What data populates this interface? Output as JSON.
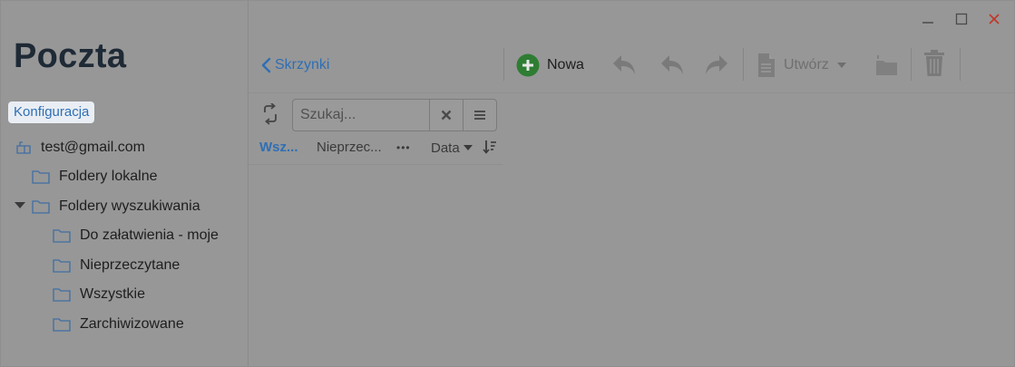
{
  "app": {
    "title": "Poczta"
  },
  "sidebar": {
    "config_label": "Konfiguracja",
    "account": "test@gmail.com",
    "folders": [
      {
        "label": "Foldery lokalne"
      },
      {
        "label": "Foldery wyszukiwania"
      }
    ],
    "search_folders": [
      {
        "label": "Do załatwienia - moje"
      },
      {
        "label": "Nieprzeczytane"
      },
      {
        "label": "Wszystkie"
      },
      {
        "label": "Zarchiwizowane"
      }
    ]
  },
  "toolbar": {
    "back_label": "Skrzynki",
    "new_label": "Nowa",
    "create_label": "Utwórz"
  },
  "search": {
    "placeholder": "Szukaj..."
  },
  "filters": {
    "all": "Wsz...",
    "unread": "Nieprzec...",
    "more": "•••",
    "sort": "Data"
  },
  "colors": {
    "accent": "#2f6fb5",
    "new_button": "#2e7d32",
    "close": "#c0392b"
  }
}
